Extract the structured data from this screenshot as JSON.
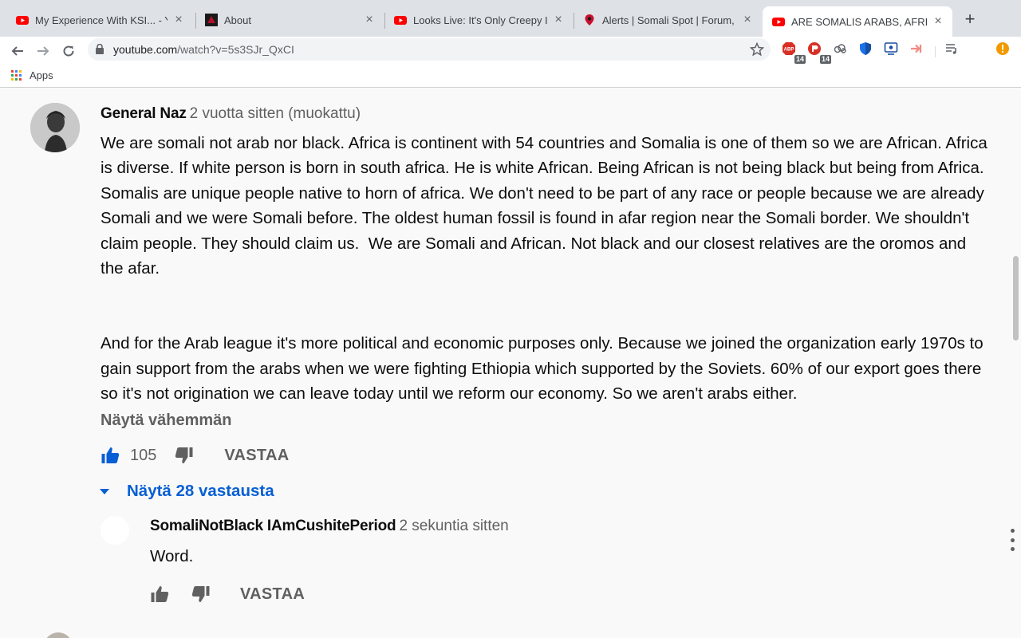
{
  "tabs": [
    {
      "title": "My Experience With KSI... - YouTube",
      "icon": "youtube-icon"
    },
    {
      "title": "About",
      "icon": "dark-site-icon"
    },
    {
      "title": "Looks Live: It's Only Creepy If...",
      "icon": "youtube-icon"
    },
    {
      "title": "Alerts | Somali Spot | Forum, News",
      "icon": "map-pin-icon"
    },
    {
      "title": "ARE SOMALIS ARABS, AFRICAN",
      "icon": "youtube-icon",
      "active": true
    }
  ],
  "omnibox": {
    "domain": "youtube.com",
    "path": "/watch?v=5s3SJr_QxCI"
  },
  "extensions": {
    "adblock_badge": "14",
    "second_badge": "14"
  },
  "bookmarks": {
    "apps_label": "Apps"
  },
  "comment": {
    "author": "General Naz",
    "meta": "2 vuotta sitten (muokattu)",
    "text": "We are somali not arab nor black. Africa is continent with 54 countries and Somalia is one of them so we are African. Africa is diverse. If white person is born in south africa. He is white African. Being African is not being black but being from Africa. Somalis are unique people native to horn of africa. We don't need to be part of any race or people because we are already Somali and we were Somali before. The oldest human fossil is found in afar region near the Somali border. We shouldn't claim people. They should claim us.  We are Somali and African. Not black and our closest relatives are the oromos and the afar.\n\n\nAnd for the Arab league it's more political and economic purposes only. Because we joined the organization early 1970s to gain support from the arabs when we were fighting Ethiopia which supported by the Soviets. 60% of our export goes there so it's not origination we can leave today until we reform our economy. So we aren't arabs either.",
    "show_less": "Näytä vähemmän",
    "likes": "105",
    "reply_label": "VASTAA",
    "replies_toggle": "Näytä 28 vastausta"
  },
  "reply": {
    "author": "SomaliNotBlack IAmCushitePeriod",
    "meta": "2 sekuntia sitten",
    "text": "Word.",
    "reply_label": "VASTAA"
  },
  "colors": {
    "link_blue": "#065fd4",
    "youtube_red": "#ff0000",
    "like_active": "#065fd4"
  }
}
